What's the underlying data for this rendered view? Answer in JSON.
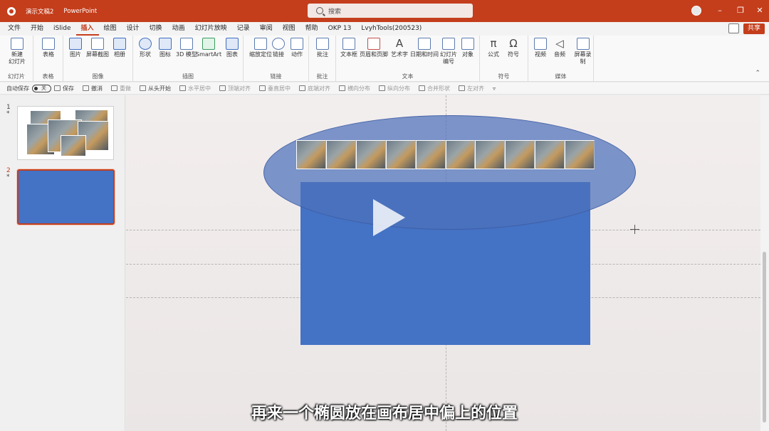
{
  "titlebar": {
    "doc_title": "演示文稿2",
    "app_name": "PowerPoint",
    "search_placeholder": "搜索",
    "accent": "#c43e1c"
  },
  "tabs": [
    "文件",
    "开始",
    "iSlide",
    "插入",
    "绘图",
    "设计",
    "切换",
    "动画",
    "幻灯片放映",
    "记录",
    "审阅",
    "视图",
    "帮助",
    "OKP 13",
    "LvyhTools(200523)"
  ],
  "active_tab": "插入",
  "share_label": "共享",
  "ribbon": {
    "groups": [
      {
        "label": "幻灯片",
        "items": [
          "新建\n幻灯片"
        ]
      },
      {
        "label": "表格",
        "items": [
          "表格"
        ]
      },
      {
        "label": "图像",
        "items": [
          "图片",
          "屏幕截图",
          "相册"
        ]
      },
      {
        "label": "插图",
        "items": [
          "形状",
          "图标",
          "3D 模型",
          "SmartArt",
          "图表"
        ]
      },
      {
        "label": "链接",
        "items": [
          "缩放定位",
          "链接",
          "动作"
        ]
      },
      {
        "label": "批注",
        "items": [
          "批注"
        ]
      },
      {
        "label": "文本",
        "items": [
          "文本框",
          "页眉和页脚",
          "艺术字",
          "日期和时间",
          "幻灯片编号",
          "对象"
        ]
      },
      {
        "label": "符号",
        "items": [
          "公式",
          "符号"
        ]
      },
      {
        "label": "媒体",
        "items": [
          "视频",
          "音频",
          "屏幕录制"
        ]
      }
    ]
  },
  "qat": {
    "autosave_label": "自动保存",
    "autosave_state": "关",
    "items": [
      "保存",
      "撤消",
      "重做",
      "从头开始",
      "水平居中",
      "顶端对齐",
      "垂直居中",
      "底端对齐",
      "横向分布",
      "纵向分布",
      "合并形状",
      "左对齐"
    ]
  },
  "slides": [
    {
      "number": "1",
      "mark": "*"
    },
    {
      "number": "2",
      "mark": "*"
    }
  ],
  "canvas": {
    "rect_color": "#4472c4",
    "ellipse_color": "#4c70ba"
  },
  "subtitle": "再来一个椭圆放在画布居中偏上的位置"
}
